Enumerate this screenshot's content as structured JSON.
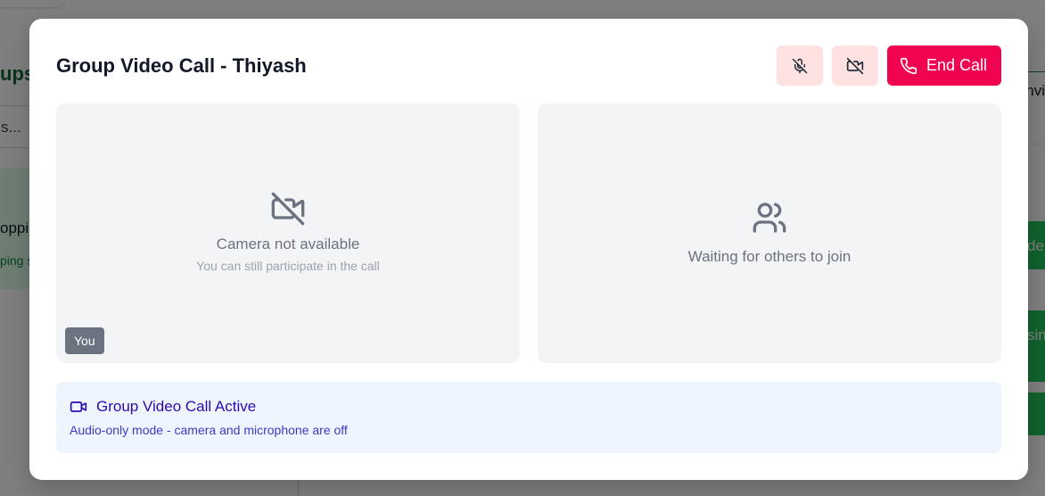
{
  "background": {
    "left_title": "ups",
    "search_placeholder": "s...",
    "group_name": "oppin",
    "group_subtitle": "ping s",
    "right_header": "nvi",
    "right_button_1": "de",
    "right_button_2": "sin"
  },
  "modal": {
    "title": "Group Video Call - Thiyash",
    "controls": {
      "mute_icon": "mic-off-icon",
      "camera_icon": "video-off-icon",
      "end_call_label": "End Call",
      "end_call_icon": "phone-icon"
    },
    "self_tile": {
      "icon": "video-off-icon",
      "message": "Camera not available",
      "submessage": "You can still participate in the call",
      "badge": "You"
    },
    "others_tile": {
      "icon": "users-icon",
      "message": "Waiting for others to join"
    },
    "status": {
      "icon": "video-icon",
      "title": "Group Video Call Active",
      "subtitle": "Audio-only mode - camera and microphone are off"
    }
  },
  "colors": {
    "end_call": "#f0044f",
    "control_bg": "#fee2e2",
    "status_bg": "#eef5ff",
    "status_text": "#2b0bb0",
    "tile_bg": "#f3f4f6"
  }
}
